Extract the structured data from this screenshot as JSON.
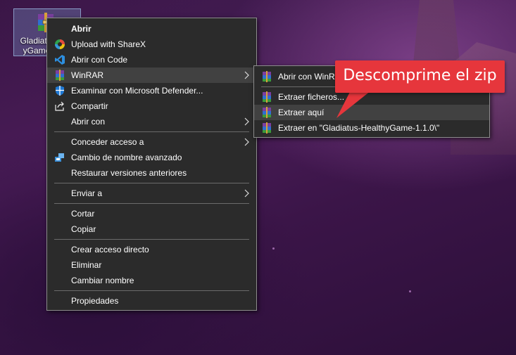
{
  "desktop_icon": {
    "caption_line1": "Gladiatus",
    "caption_line2": "yGame-"
  },
  "context_menu": {
    "items": [
      {
        "label": "Abrir",
        "bold": true,
        "icon": "none"
      },
      {
        "label": "Upload with ShareX",
        "icon": "sharex-icon"
      },
      {
        "label": "Abrir con Code",
        "icon": "vscode-icon"
      },
      {
        "label": "WinRAR",
        "icon": "winrar-icon",
        "submenu": true
      },
      {
        "label": "Examinar con Microsoft Defender...",
        "icon": "defender-icon"
      },
      {
        "label": "Compartir",
        "icon": "share-icon"
      },
      {
        "label": "Abrir con",
        "icon": "none",
        "submenu": true
      },
      {
        "label": "Conceder acceso a",
        "icon": "none",
        "submenu": true
      },
      {
        "label": "Cambio de nombre avanzado",
        "icon": "rename-icon"
      },
      {
        "label": "Restaurar versiones anteriores",
        "icon": "none"
      },
      {
        "label": "Enviar a",
        "icon": "none",
        "submenu": true
      },
      {
        "label": "Cortar",
        "icon": "none"
      },
      {
        "label": "Copiar",
        "icon": "none"
      },
      {
        "label": "Crear acceso directo",
        "icon": "none"
      },
      {
        "label": "Eliminar",
        "icon": "none"
      },
      {
        "label": "Cambiar nombre",
        "icon": "none"
      },
      {
        "label": "Propiedades",
        "icon": "none"
      }
    ]
  },
  "winrar_submenu": {
    "items": [
      {
        "label": "Abrir con WinRAR",
        "icon": "winrar-icon"
      },
      {
        "label": "Extraer ficheros...",
        "icon": "winrar-icon"
      },
      {
        "label": "Extraer aquí",
        "icon": "winrar-icon"
      },
      {
        "label": "Extraer en \"Gladiatus-HealthyGame-1.1.0\\\"",
        "icon": "winrar-icon"
      }
    ]
  },
  "annotation": {
    "text": "Descomprime el zip",
    "color": "#e6363c"
  },
  "colors": {
    "menu_bg": "#2b2b2b",
    "menu_hover": "#414141",
    "menu_border": "#8c8c8c"
  }
}
